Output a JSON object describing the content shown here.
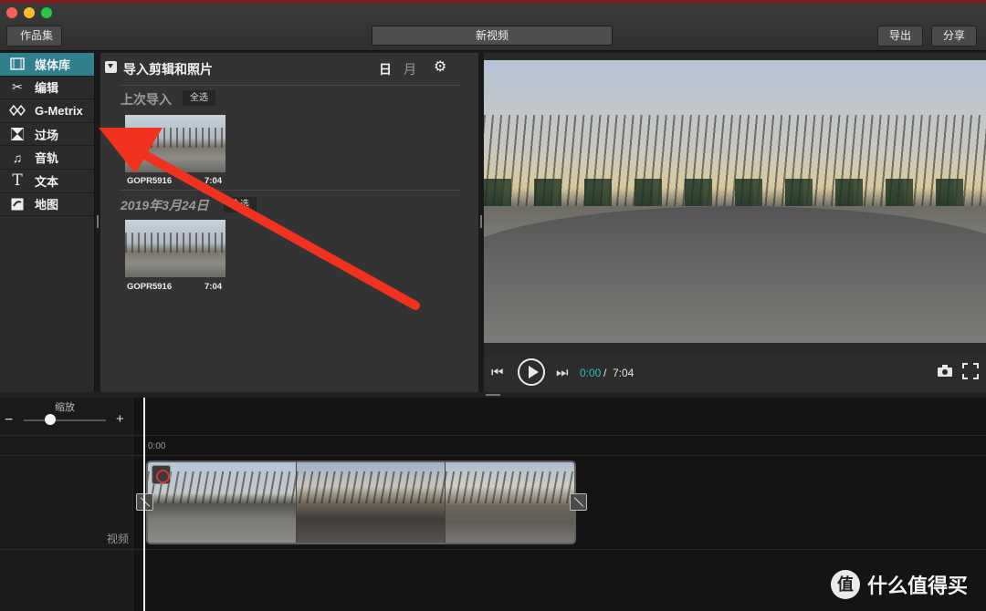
{
  "toolbar": {
    "back_label": "作品集",
    "project_title": "新视频",
    "export_label": "导出",
    "share_label": "分享"
  },
  "sidebar": {
    "items": [
      {
        "label": "媒体库",
        "icon": "film-icon",
        "active": true
      },
      {
        "label": "编辑",
        "icon": "scissors-icon",
        "active": false
      },
      {
        "label": "G-Metrix",
        "icon": "gauge-icon",
        "active": false
      },
      {
        "label": "过场",
        "icon": "transition-icon",
        "active": false
      },
      {
        "label": "音轨",
        "icon": "music-note-icon",
        "active": false
      },
      {
        "label": "文本",
        "icon": "text-icon",
        "active": false
      },
      {
        "label": "地图",
        "icon": "map-icon",
        "active": false
      }
    ]
  },
  "media": {
    "import_label": "导入剪辑和照片",
    "view_day": "日",
    "view_month": "月",
    "groups": [
      {
        "title": "上次导入",
        "select_all": "全选",
        "clips": [
          {
            "name": "GOPR5916",
            "duration": "7:04"
          }
        ]
      },
      {
        "title": "2019年3月24日",
        "select_all": "全选",
        "clips": [
          {
            "name": "GOPR5916",
            "duration": "7:04"
          }
        ]
      }
    ]
  },
  "player": {
    "current_time": "0:00",
    "separator": "/",
    "total_time": "7:04"
  },
  "timeline": {
    "zoom_label": "缩放",
    "zoom_minus": "−",
    "zoom_plus": "+",
    "ruler_start": "0:00",
    "track_label": "视频"
  },
  "watermark": {
    "logo_glyph": "值",
    "text": "什么值得买"
  },
  "colors": {
    "accent": "#2f7f8d",
    "time_current": "#34b4c8",
    "annotation_arrow": "#f0321e"
  }
}
